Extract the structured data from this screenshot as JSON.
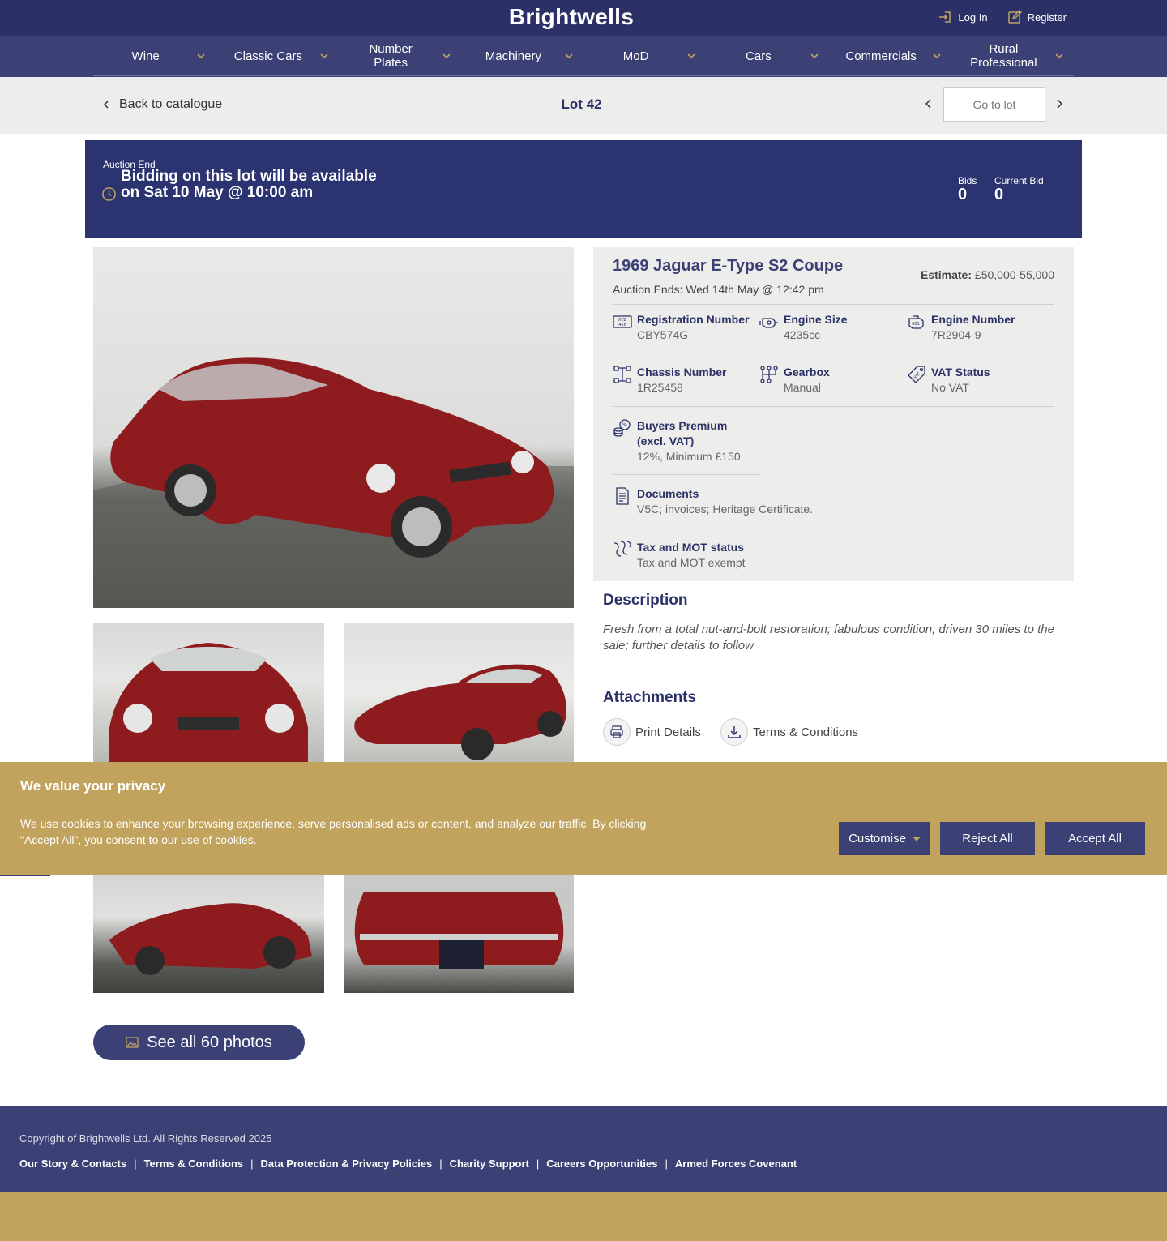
{
  "header": {
    "logo": "Brightwells",
    "login_label": "Log In",
    "register_label": "Register"
  },
  "nav": {
    "items": [
      {
        "label": "Wine"
      },
      {
        "label": "Classic Cars"
      },
      {
        "label": "Number Plates"
      },
      {
        "label": "Machinery"
      },
      {
        "label": "MoD"
      },
      {
        "label": "Cars"
      },
      {
        "label": "Commercials"
      },
      {
        "label": "Rural Professional"
      }
    ]
  },
  "lotbar": {
    "back_label": "Back to catalogue",
    "lot_title": "Lot 42",
    "goto_placeholder": "Go to lot"
  },
  "banner": {
    "label": "Auction End",
    "message": "Bidding on this lot will be available on Sat 10 May @ 10:00 am",
    "bids_label": "Bids",
    "bids_value": "0",
    "current_bid_label": "Current Bid",
    "current_bid_value": "0"
  },
  "lot": {
    "title": "1969 Jaguar E-Type S2 Coupe",
    "auction_ends": "Auction Ends: Wed 14th May @ 12:42 pm",
    "estimate_label": "Estimate:",
    "estimate_value": "£50,000-55,000",
    "specs": {
      "registration": {
        "label": "Registration Number",
        "value": "CBY574G",
        "icon": "registration-plate-icon"
      },
      "engine_size": {
        "label": "Engine Size",
        "value": "4235cc",
        "icon": "engine-icon"
      },
      "engine_number": {
        "label": "Engine Number",
        "value": "7R2904-9",
        "icon": "engine-number-icon"
      },
      "chassis": {
        "label": "Chassis Number",
        "value": "1R25458",
        "icon": "chassis-icon"
      },
      "gearbox": {
        "label": "Gearbox",
        "value": "Manual",
        "icon": "gearbox-icon"
      },
      "vat": {
        "label": "VAT Status",
        "value": "No VAT",
        "icon": "vat-tag-icon"
      },
      "premium": {
        "label": "Buyers Premium (excl. VAT)",
        "value": "12%, Minimum £150",
        "icon": "coins-percent-icon"
      },
      "documents": {
        "label": "Documents",
        "value": "V5C; invoices; Heritage Certificate.",
        "icon": "document-icon"
      },
      "tax_mot": {
        "label": "Tax and MOT status",
        "value": "Tax and MOT exempt",
        "icon": "road-icon"
      }
    },
    "description_heading": "Description",
    "description": "Fresh from a total nut-and-bolt restoration; fabulous condition; driven 30 miles to the sale; further details to follow",
    "attachments_heading": "Attachments",
    "print_label": "Print Details",
    "terms_label": "Terms & Conditions",
    "see_all_label": "See all 60 photos"
  },
  "cookie": {
    "title": "We value your privacy",
    "text": "We use cookies to enhance your browsing experience, serve personalised ads or content, and analyze our traffic. By clicking \"Accept All\", you consent to our use of cookies.",
    "customise_label": "Customise",
    "reject_label": "Reject All",
    "accept_label": "Accept All"
  },
  "footer": {
    "copyright": "Copyright of Brightwells Ltd. All Rights Reserved 2025",
    "links": [
      "Our Story & Contacts",
      "Terms & Conditions",
      "Data Protection & Privacy Policies",
      "Charity Support",
      "Careers Opportunities",
      "Armed Forces Covenant"
    ]
  },
  "colors": {
    "navy": "#2b3167",
    "nav_purple": "#3b4075",
    "gold": "#c2a35e",
    "panel_grey": "#ededeb"
  }
}
